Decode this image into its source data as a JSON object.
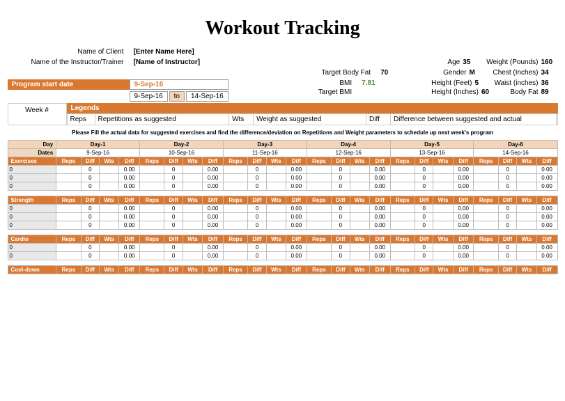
{
  "title": "Workout Tracking",
  "labels": {
    "client": "Name of Client",
    "instructor": "Name of the Instructor/Trainer",
    "programStart": "Program start date",
    "weekNum": "Week #",
    "targetBodyFat": "Target Body Fat",
    "bmi": "BMI",
    "targetBmi": "Target BMI",
    "age": "Age",
    "gender": "Gender",
    "heightFt": "Height (Feet)",
    "heightIn": "Height (Inches)",
    "weight": "Weight (Pounds)",
    "chest": "Chest (Inches)",
    "waist": "Waist (inches)",
    "bodyFat": "Body Fat",
    "to": "to",
    "legends": "Legends",
    "day": "Day",
    "dates": "Dates"
  },
  "values": {
    "client": "[Enter Name Here]",
    "instructor": "[Name of Instructor]",
    "programStart": "9-Sep-16",
    "startDate": "9-Sep-16",
    "endDate": "14-Sep-16",
    "targetBodyFat": "70",
    "bmi": "7.81",
    "age": "35",
    "gender": "M",
    "heightFt": "5",
    "heightIn": "60",
    "weight": "160",
    "chest": "34",
    "waist": "36",
    "bodyFat": "89"
  },
  "legend": {
    "reps": "Reps",
    "repsDesc": "Repetitions as suggested",
    "wts": "Wts",
    "wtsDesc": "Weight as suggested",
    "diff": "Diff",
    "diffDesc": "Difference between suggested and actual"
  },
  "instruction": "Please Fill the actual data for suggested exercises and find the difference/deviation on Repetitions and Weight parameters to schedule up next week's program",
  "days": [
    "Day-1",
    "Day-2",
    "Day-3",
    "Day-4",
    "Day-5",
    "Day-6"
  ],
  "dates": [
    "9-Sep-16",
    "10-Sep-16",
    "11-Sep-16",
    "12-Sep-16",
    "13-Sep-16",
    "14-Sep-16"
  ],
  "cols": [
    "Reps",
    "Diff",
    "Wts",
    "Diff"
  ],
  "sections": {
    "exercises": "Exercises",
    "strength": "Strength",
    "cardio": "Cardio",
    "cooldown": "Cool-down"
  },
  "rowLead": "0",
  "cellZero": "0",
  "cellZeroDec": "0.00"
}
